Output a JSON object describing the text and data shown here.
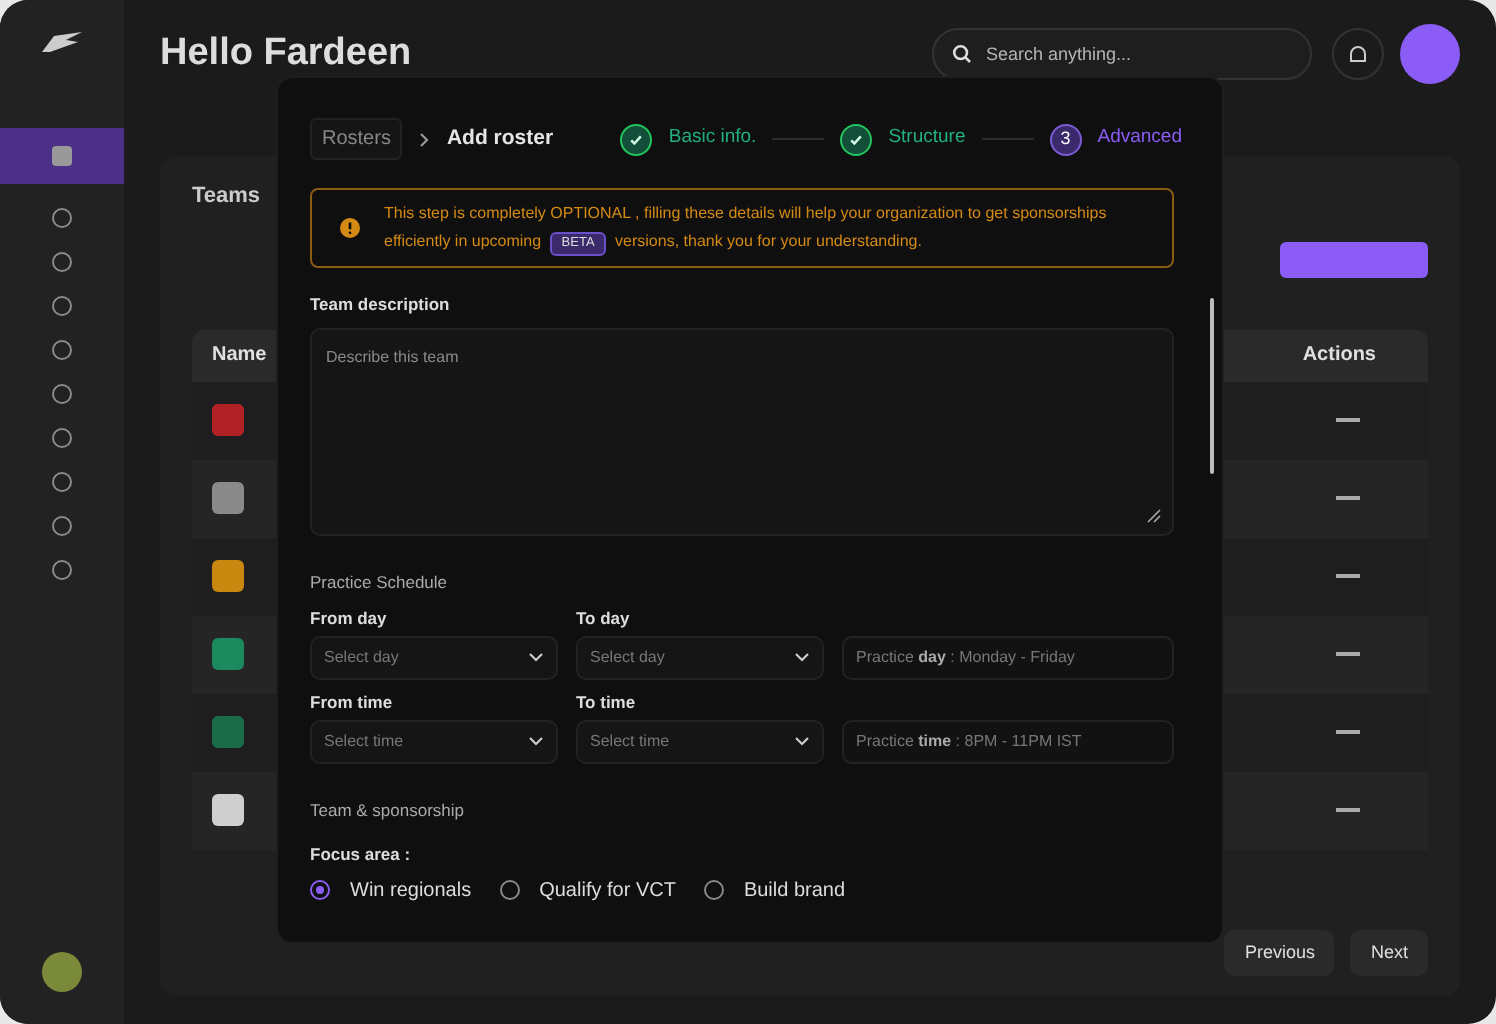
{
  "background": {
    "greeting": "Hello Fardeen",
    "search": {
      "placeholder": "Search anything..."
    },
    "panel_title": "Teams",
    "columns": [
      "Name",
      "Actions"
    ],
    "pager": [
      "Previous",
      "Next"
    ]
  },
  "modal": {
    "breadcrumb": {
      "parent": "Rosters",
      "current": "Add roster"
    },
    "steps": [
      {
        "label": "Basic info.",
        "completed": true,
        "current": false
      },
      {
        "label": "Structure",
        "completed": true,
        "current": false
      },
      {
        "label": "Advanced",
        "number": "3",
        "completed": false,
        "current": true
      }
    ],
    "notice": {
      "before": "This step is completely OPTIONAL , filling these details will help your organization to get sponsorships efficiently in upcoming",
      "badge": "BETA",
      "after": "versions, thank you for your understanding."
    },
    "description": {
      "label": "Team description",
      "placeholder": "Describe this team"
    },
    "schedule": {
      "heading": "Practice Schedule",
      "rows": [
        {
          "fields": [
            {
              "kind": "select",
              "label": "From day",
              "placeholder": "Select day"
            },
            {
              "kind": "select",
              "label": "To day",
              "placeholder": "Select day"
            },
            {
              "kind": "info",
              "text": "Practice **day** : Monday - Friday"
            }
          ]
        },
        {
          "fields": [
            {
              "kind": "select",
              "label": "From time",
              "placeholder": "Select time"
            },
            {
              "kind": "select",
              "label": "To time",
              "placeholder": "Select time"
            },
            {
              "kind": "info",
              "text": "Practice **time** : 8PM - 11PM IST"
            }
          ]
        }
      ]
    },
    "sponsorship": {
      "heading": "Team & sponsorship",
      "focus_label": "Focus area :",
      "options": [
        {
          "label": "Win regionals",
          "selected": true
        },
        {
          "label": "Qualify for VCT",
          "selected": false
        },
        {
          "label": "Build brand",
          "selected": false
        }
      ]
    }
  }
}
